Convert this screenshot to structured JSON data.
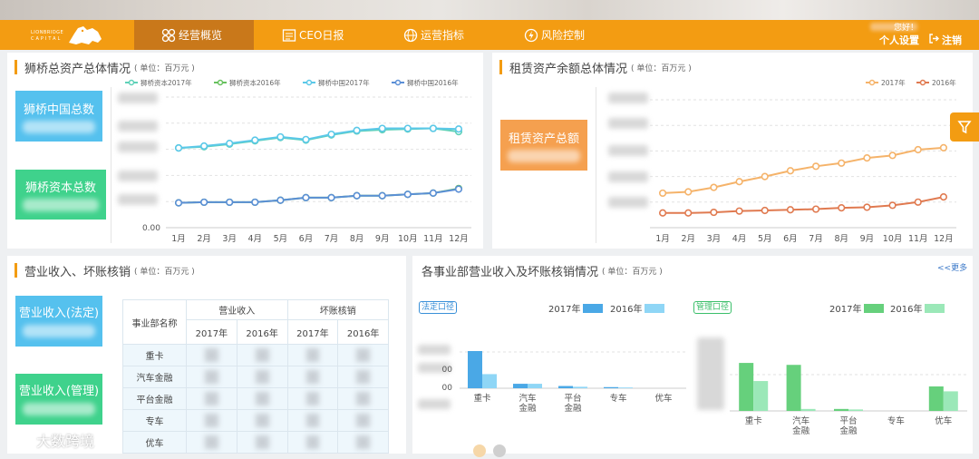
{
  "nav": {
    "logo_line1": "LIONBRIDGE",
    "logo_line2": "CAPITAL",
    "items": [
      {
        "label": "经营概览",
        "icon": "overview-icon"
      },
      {
        "label": "CEO日报",
        "icon": "report-icon"
      },
      {
        "label": "运营指标",
        "icon": "globe-icon"
      },
      {
        "label": "风险控制",
        "icon": "risk-icon"
      }
    ],
    "greeting": "您好！",
    "settings_label": "个人设置",
    "logout_label": "注销",
    "accent": "#f39c12"
  },
  "panel1": {
    "title": "狮桥总资产总体情况",
    "unit": "( 单位：百万元 )",
    "kpi_top": "狮桥中国总数",
    "kpi_bottom": "狮桥资本总数",
    "chart_data": {
      "type": "line",
      "categories": [
        "1月",
        "2月",
        "3月",
        "4月",
        "5月",
        "6月",
        "7月",
        "8月",
        "9月",
        "10月",
        "11月",
        "12月"
      ],
      "series": [
        {
          "name": "狮桥资本2017年",
          "color": "#5fd1b8",
          "values": [
            0.61,
            0.62,
            0.64,
            0.665,
            0.69,
            0.67,
            0.71,
            0.74,
            0.75,
            0.755,
            0.76,
            0.735
          ]
        },
        {
          "name": "狮桥资本2016年",
          "color": "#67c15e",
          "values": [
            0.19,
            0.195,
            0.195,
            0.195,
            0.21,
            0.23,
            0.23,
            0.245,
            0.245,
            0.255,
            0.265,
            0.3
          ]
        },
        {
          "name": "狮桥中国2017年",
          "color": "#5bc8e8",
          "values": [
            0.61,
            0.625,
            0.645,
            0.67,
            0.695,
            0.675,
            0.715,
            0.745,
            0.76,
            0.76,
            0.76,
            0.755
          ]
        },
        {
          "name": "狮桥中国2016年",
          "color": "#5b8fd6",
          "values": [
            0.19,
            0.195,
            0.195,
            0.195,
            0.21,
            0.23,
            0.23,
            0.245,
            0.245,
            0.255,
            0.265,
            0.295
          ]
        }
      ],
      "y_tick_label": "0.00",
      "ylim": [
        0,
        1
      ]
    }
  },
  "panel2": {
    "title": "租赁资产余额总体情况",
    "unit": "( 单位：百万元 )",
    "kpi": "租赁资产总额",
    "chart_data": {
      "type": "line",
      "categories": [
        "1月",
        "2月",
        "3月",
        "4月",
        "5月",
        "6月",
        "7月",
        "8月",
        "9月",
        "10月",
        "11月",
        "12月"
      ],
      "series": [
        {
          "name": "2017年",
          "color": "#f5b36a",
          "values": [
            0.27,
            0.28,
            0.315,
            0.36,
            0.4,
            0.445,
            0.48,
            0.505,
            0.545,
            0.565,
            0.61,
            0.625
          ]
        },
        {
          "name": "2016年",
          "color": "#e07a50",
          "values": [
            0.115,
            0.115,
            0.12,
            0.13,
            0.135,
            0.14,
            0.145,
            0.155,
            0.16,
            0.175,
            0.2,
            0.24
          ]
        }
      ],
      "ylim": [
        0,
        1
      ]
    }
  },
  "panel3": {
    "title": "营业收入、坏账核销",
    "unit": "( 单位：百万元 )",
    "kpi_top": "营业收入(法定)",
    "kpi_bottom": "营业收入(管理)",
    "table": {
      "col_dept": "事业部名称",
      "group_revenue": "营业收入",
      "group_writeoff": "坏账核销",
      "years": [
        "2017年",
        "2016年",
        "2017年",
        "2016年"
      ],
      "rows": [
        "重卡",
        "汽车金融",
        "平台金融",
        "专车",
        "优车"
      ]
    }
  },
  "panel4": {
    "title": "各事业部营业收入及坏账核销情况",
    "unit": "( 单位：百万元 )",
    "more": "<<更多",
    "left_tag": "法定口径",
    "right_tag": "管理口径",
    "left_chart": {
      "type": "bar",
      "categories": [
        "重卡",
        "汽车\n金融",
        "平台\n金融",
        "专车",
        "优车"
      ],
      "tick_suffix": "00",
      "series": [
        {
          "name": "2017年",
          "color": "#4aa8e6",
          "values": [
            1.0,
            0.12,
            0.06,
            0.03,
            0.0
          ]
        },
        {
          "name": "2016年",
          "color": "#8fd6f6",
          "values": [
            0.38,
            0.12,
            0.04,
            0.02,
            0.0
          ]
        }
      ]
    },
    "right_chart": {
      "type": "bar",
      "categories": [
        "重卡",
        "汽车\n金融",
        "平台\n金融",
        "专车",
        "优车"
      ],
      "series": [
        {
          "name": "2017年",
          "color": "#66d07c",
          "values": [
            0.98,
            0.94,
            0.04,
            0.0,
            0.5
          ]
        },
        {
          "name": "2016年",
          "color": "#9be8b8",
          "values": [
            0.61,
            0.04,
            0.03,
            0.0,
            0.4
          ]
        }
      ]
    }
  },
  "watermark": "大数跨境"
}
